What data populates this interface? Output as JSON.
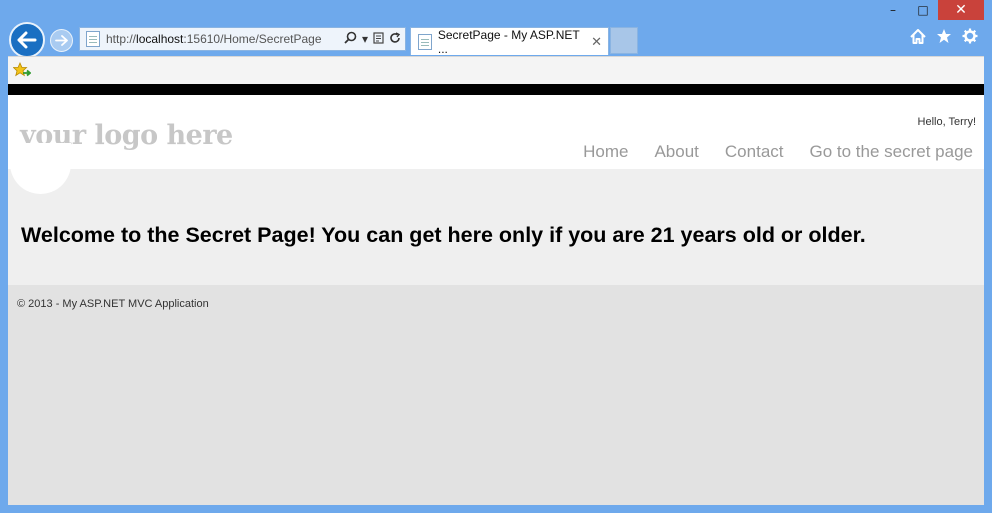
{
  "browser": {
    "window_controls": {
      "minimize": "–",
      "maximize": "□",
      "close": "✕"
    },
    "address": {
      "scheme": "http://",
      "host": "localhost",
      "path": ":15610/Home/SecretPage"
    },
    "tab": {
      "title": "SecretPage - My ASP.NET ...",
      "close": "✕"
    },
    "icons": [
      "home-icon",
      "favorites-star-icon",
      "tools-gear-icon"
    ]
  },
  "site": {
    "logo": "your logo here",
    "greeting": "Hello, Terry!",
    "menu": [
      "Home",
      "About",
      "Contact",
      "Go to the secret page"
    ],
    "welcome": "Welcome to the Secret Page! You can get here only if you are 21 years old or older.",
    "footer": "© 2013 - My ASP.NET MVC Application"
  },
  "colors": {
    "frame": "#6ea9ec",
    "back_button": "#1a6fc2",
    "close_button": "#c9423b",
    "logo": "#c7c7c7",
    "menu": "#999999"
  }
}
